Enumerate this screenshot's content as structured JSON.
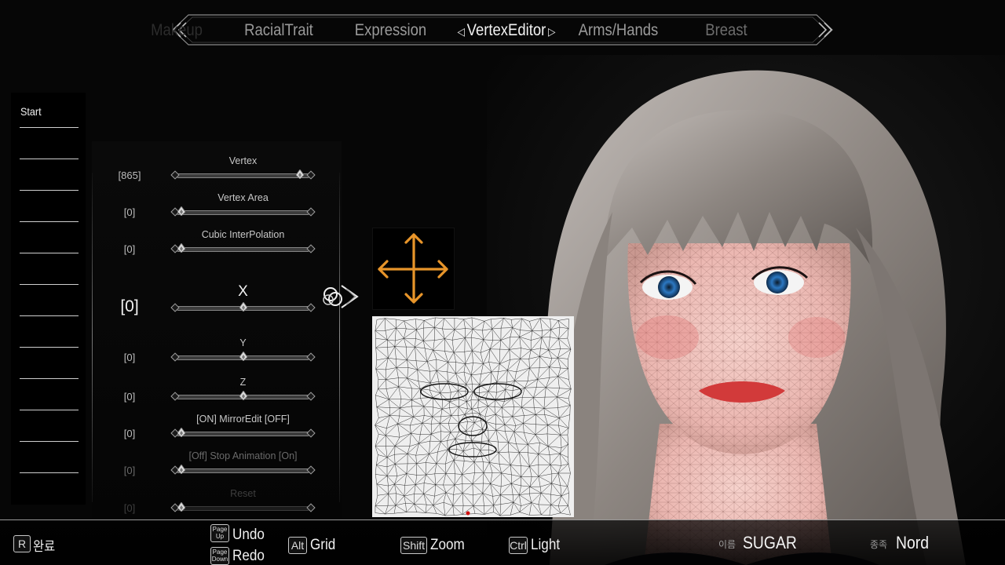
{
  "tabs": [
    {
      "label": "Makeup"
    },
    {
      "label": "RacialTrait"
    },
    {
      "label": "Expression"
    },
    {
      "label": "VertexEditor"
    },
    {
      "label": "Arms/Hands"
    },
    {
      "label": "Breast"
    }
  ],
  "sidebar": {
    "items": [
      {
        "label": "Start"
      },
      {
        "label": ""
      },
      {
        "label": ""
      },
      {
        "label": ""
      },
      {
        "label": ""
      },
      {
        "label": ""
      },
      {
        "label": ""
      },
      {
        "label": ""
      },
      {
        "label": ""
      },
      {
        "label": ""
      },
      {
        "label": ""
      },
      {
        "label": ""
      }
    ]
  },
  "sliders": [
    {
      "label": "Vertex",
      "value_text": "[865]",
      "level": 0.96
    },
    {
      "label": "Vertex Area",
      "value_text": "[0]",
      "level": 0.0
    },
    {
      "label": "Cubic InterPolation",
      "value_text": "[0]",
      "level": 0.0
    },
    {
      "label": "X",
      "value_text": "[0]",
      "level": 0.5
    },
    {
      "label": "Y",
      "value_text": "[0]",
      "level": 0.5
    },
    {
      "label": "Z",
      "value_text": "[0]",
      "level": 0.5
    },
    {
      "label": "[ON] MirrorEdit [OFF]",
      "value_text": "[0]",
      "level": 0.0
    },
    {
      "label": "[Off] Stop Animation [On]",
      "value_text": "[0]",
      "level": 0.0
    },
    {
      "label": "Reset",
      "value_text": "[0]",
      "level": 0.0
    }
  ],
  "bottom": {
    "done_key": "R",
    "done_label": "완료",
    "undo_key": "Page Up",
    "undo_label": "Undo",
    "redo_key": "Page Down",
    "redo_label": "Redo",
    "grid_key": "Alt",
    "grid_label": "Grid",
    "zoom_key": "Shift",
    "zoom_label": "Zoom",
    "light_key": "Ctrl",
    "light_label": "Light",
    "name_caption": "이름",
    "name_value": "SUGAR",
    "race_caption": "종족",
    "race_value": "Nord"
  },
  "colors": {
    "gizmo_arrow": "#e8952a",
    "accent_text": "#f2f2f2",
    "background": "#060606"
  },
  "icons": {
    "tab_prev": "chevron-left-icon",
    "tab_next": "chevron-right-icon",
    "selector": "knot-arrow-icon",
    "gizmo": "move-arrows-icon"
  }
}
